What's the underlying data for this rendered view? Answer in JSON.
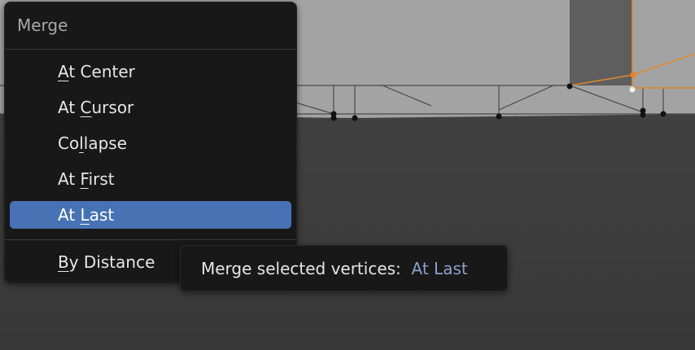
{
  "menu": {
    "title": "Merge",
    "items": [
      {
        "pre": "",
        "ul": "A",
        "post": "t Center"
      },
      {
        "pre": "At ",
        "ul": "C",
        "post": "ursor"
      },
      {
        "pre": "Co",
        "ul": "l",
        "post": "lapse"
      },
      {
        "pre": "At ",
        "ul": "F",
        "post": "irst"
      },
      {
        "pre": "At ",
        "ul": "L",
        "post": "ast"
      },
      {
        "pre": "",
        "ul": "B",
        "post": "y Distance"
      }
    ],
    "active_index": 4
  },
  "tooltip": {
    "text": "Merge selected vertices:",
    "value": "At Last"
  },
  "colors": {
    "menu_bg": "#181818",
    "highlight": "#4772b3",
    "viewport_bg": "#3d3d3d",
    "mesh": "#a2a2a2",
    "selection": "#e08a2e"
  }
}
